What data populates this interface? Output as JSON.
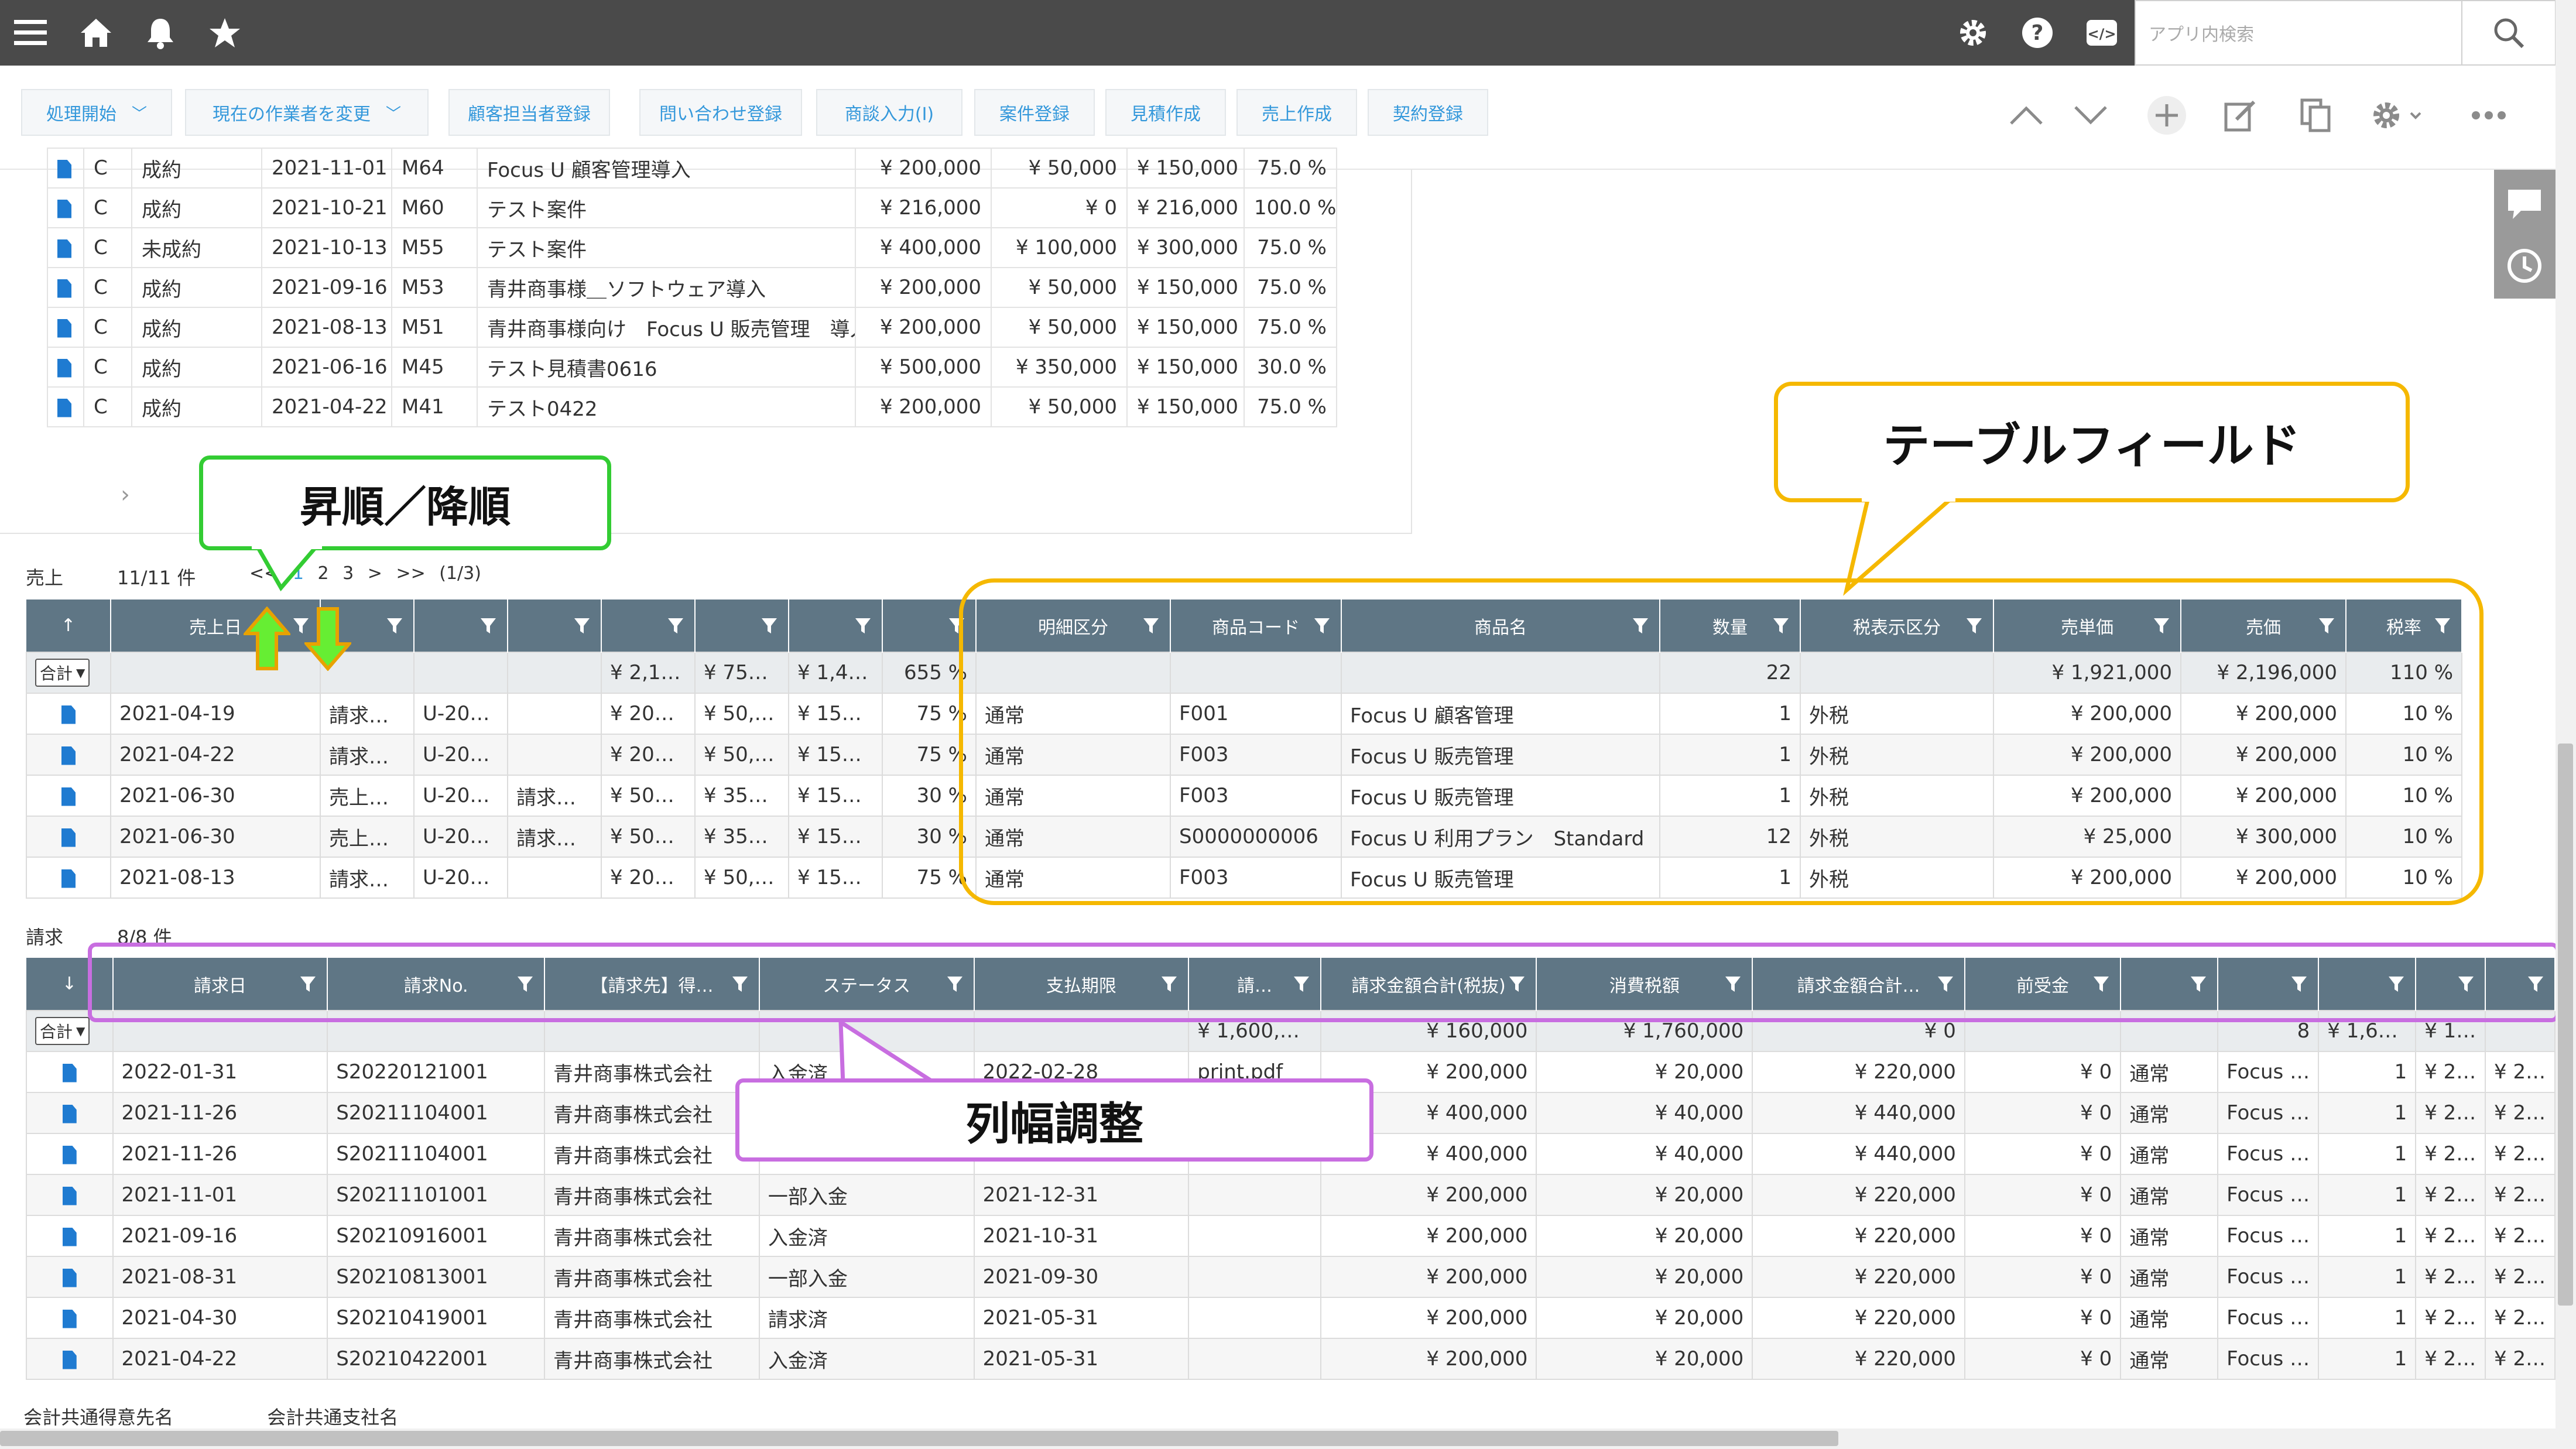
{
  "topbar": {
    "search_placeholder": "アプリ内検索"
  },
  "actions": [
    {
      "label": "処理開始",
      "dropdown": true
    },
    {
      "label": "現在の作業者を変更",
      "dropdown": true
    },
    {
      "label": "顧客担当者登録"
    },
    {
      "label": "問い合わせ登録"
    },
    {
      "label": "商談入力(I)"
    },
    {
      "label": "案件登録"
    },
    {
      "label": "見積作成"
    },
    {
      "label": "売上作成"
    },
    {
      "label": "契約登録"
    }
  ],
  "upper_table": {
    "rows": [
      [
        "C",
        "成約",
        "2021-11-01",
        "M64",
        "Focus U 顧客管理導入",
        "¥ 200,000",
        "¥ 50,000",
        "¥ 150,000",
        "75.0 %"
      ],
      [
        "C",
        "成約",
        "2021-10-21",
        "M60",
        "テスト案件",
        "¥ 216,000",
        "¥ 0",
        "¥ 216,000",
        "100.0 %"
      ],
      [
        "C",
        "未成約",
        "2021-10-13",
        "M55",
        "テスト案件",
        "¥ 400,000",
        "¥ 100,000",
        "¥ 300,000",
        "75.0 %"
      ],
      [
        "C",
        "成約",
        "2021-09-16",
        "M53",
        "青井商事様＿ソフトウェア導入",
        "¥ 200,000",
        "¥ 50,000",
        "¥ 150,000",
        "75.0 %"
      ],
      [
        "C",
        "成約",
        "2021-08-13",
        "M51",
        "青井商事様向け　Focus U 販売管理　導入",
        "¥ 200,000",
        "¥ 50,000",
        "¥ 150,000",
        "75.0 %"
      ],
      [
        "C",
        "成約",
        "2021-06-16",
        "M45",
        "テスト見積書0616",
        "¥ 500,000",
        "¥ 350,000",
        "¥ 150,000",
        "30.0 %"
      ],
      [
        "C",
        "成約",
        "2021-04-22",
        "M41",
        "テスト0422",
        "¥ 200,000",
        "¥ 50,000",
        "¥ 150,000",
        "75.0 %"
      ]
    ]
  },
  "sales": {
    "label": "売上",
    "count": "11/11 件",
    "pager": {
      "first": "<<",
      "pages": [
        "1",
        "2",
        "3"
      ],
      "current": "1",
      "next": ">",
      "last": ">>",
      "info": "(1/3)"
    },
    "headers": [
      "↑",
      "売上日",
      "",
      "",
      "",
      "",
      "",
      "",
      "",
      "明細区分",
      "商品コード",
      "商品名",
      "数量",
      "税表示区分",
      "売単価",
      "売価",
      "税率"
    ],
    "total_select": "合計",
    "totals": [
      "",
      "",
      "",
      "",
      "",
      "¥ 2,19…",
      "¥ 750,…",
      "¥ 1,44…",
      "655 %",
      "",
      "",
      "",
      "22",
      "",
      "¥ 1,921,000",
      "¥ 2,196,000",
      "110 %"
    ],
    "rows": [
      [
        "2021-04-19",
        "請求処…",
        "U-202…",
        "",
        "¥ 200,…",
        "¥ 50,0…",
        "¥ 150,…",
        "75 %",
        "通常",
        "F001",
        "Focus U 顧客管理",
        "1",
        "外税",
        "¥ 200,000",
        "¥ 200,000",
        "10 %"
      ],
      [
        "2021-04-22",
        "請求処…",
        "U-202…",
        "",
        "¥ 200,…",
        "¥ 50,0…",
        "¥ 150,…",
        "75 %",
        "通常",
        "F003",
        "Focus U 販売管理",
        "1",
        "外税",
        "¥ 200,000",
        "¥ 200,000",
        "10 %"
      ],
      [
        "2021-06-30",
        "売上未…",
        "U-202…",
        "請求書…",
        "¥ 500,…",
        "¥ 350,…",
        "¥ 150,…",
        "30 %",
        "通常",
        "F003",
        "Focus U 販売管理",
        "1",
        "外税",
        "¥ 200,000",
        "¥ 200,000",
        "10 %"
      ],
      [
        "2021-06-30",
        "売上未…",
        "U-202…",
        "請求書…",
        "¥ 500,…",
        "¥ 350,…",
        "¥ 150,…",
        "30 %",
        "通常",
        "S0000000006",
        "Focus U 利用プラン　Standard",
        "12",
        "外税",
        "¥ 25,000",
        "¥ 300,000",
        "10 %"
      ],
      [
        "2021-08-13",
        "請求処…",
        "U-202…",
        "",
        "¥ 200,…",
        "¥ 50,0…",
        "¥ 150,…",
        "75 %",
        "通常",
        "F003",
        "Focus U 販売管理",
        "1",
        "外税",
        "¥ 200,000",
        "¥ 200,000",
        "10 %"
      ]
    ]
  },
  "invoice": {
    "label": "請求",
    "count": "8/8 件",
    "headers": [
      "↓",
      "請求日",
      "請求No.",
      "【請求先】得…",
      "ステータス",
      "支払期限",
      "請…",
      "請求金額合計(税抜)",
      "消費税額",
      "請求金額合計…",
      "前受金",
      "",
      "",
      "",
      "",
      ""
    ],
    "total_select": "合計",
    "totals": [
      "",
      "",
      "",
      "",
      "",
      "",
      "¥ 1,600,000",
      "¥ 160,000",
      "¥ 1,760,000",
      "¥ 0",
      "",
      "",
      "8",
      "¥ 1,60…",
      "¥ 1,60…"
    ],
    "rows": [
      [
        "2022-01-31",
        "S20220121001",
        "青井商事株式会社",
        "入金済",
        "2022-02-28",
        "print.pdf",
        "¥ 200,000",
        "¥ 20,000",
        "¥ 220,000",
        "¥ 0",
        "通常",
        "Focus …",
        "1",
        "¥ 200,…",
        "¥ 200,…"
      ],
      [
        "2021-11-26",
        "S20211104001",
        "青井商事株式会社",
        "",
        "",
        "",
        "¥ 400,000",
        "¥ 40,000",
        "¥ 440,000",
        "¥ 0",
        "通常",
        "Focus …",
        "1",
        "¥ 200,…",
        "¥ 200,…"
      ],
      [
        "2021-11-26",
        "S20211104001",
        "青井商事株式会社",
        "",
        "",
        "",
        "¥ 400,000",
        "¥ 40,000",
        "¥ 440,000",
        "¥ 0",
        "通常",
        "Focus …",
        "1",
        "¥ 200,…",
        "¥ 200,…"
      ],
      [
        "2021-11-01",
        "S20211101001",
        "青井商事株式会社",
        "一部入金",
        "2021-12-31",
        "",
        "¥ 200,000",
        "¥ 20,000",
        "¥ 220,000",
        "¥ 0",
        "通常",
        "Focus …",
        "1",
        "¥ 200,…",
        "¥ 200,…"
      ],
      [
        "2021-09-16",
        "S20210916001",
        "青井商事株式会社",
        "入金済",
        "2021-10-31",
        "",
        "¥ 200,000",
        "¥ 20,000",
        "¥ 220,000",
        "¥ 0",
        "通常",
        "Focus …",
        "1",
        "¥ 200,…",
        "¥ 200,…"
      ],
      [
        "2021-08-31",
        "S20210813001",
        "青井商事株式会社",
        "一部入金",
        "2021-09-30",
        "",
        "¥ 200,000",
        "¥ 20,000",
        "¥ 220,000",
        "¥ 0",
        "通常",
        "Focus …",
        "1",
        "¥ 200,…",
        "¥ 200,…"
      ],
      [
        "2021-04-30",
        "S20210419001",
        "青井商事株式会社",
        "請求済",
        "2021-05-31",
        "",
        "¥ 200,000",
        "¥ 20,000",
        "¥ 220,000",
        "¥ 0",
        "通常",
        "Focus …",
        "1",
        "¥ 200,…",
        "¥ 200,…"
      ],
      [
        "2021-04-22",
        "S20210422001",
        "青井商事株式会社",
        "入金済",
        "2021-05-31",
        "",
        "¥ 200,000",
        "¥ 20,000",
        "¥ 220,000",
        "¥ 0",
        "通常",
        "Focus …",
        "1",
        "¥ 200,…",
        "¥ 200,…"
      ]
    ]
  },
  "callouts": {
    "sort": "昇順／降順",
    "table_field": "テーブルフィールド",
    "column_width": "列幅調整"
  },
  "callout_colors": {
    "sort": "#33cc33",
    "table_field": "#f5b800",
    "column_width": "#c86ee0"
  },
  "bottom": {
    "label1": "会計共通得意先名",
    "label2": "会計共通支社名"
  },
  "colors": {
    "topbar": "#4a4a4a",
    "accent": "#3498db",
    "header": "#5f7685",
    "doc_icon": "#1f7bd1"
  },
  "icons": [
    "menu-icon",
    "home-icon",
    "bell-icon",
    "star-icon",
    "gear-icon",
    "help-icon",
    "code-icon",
    "search-icon",
    "chevron-up-icon",
    "chevron-down-icon",
    "plus-icon",
    "edit-icon",
    "copy-icon",
    "more-icon",
    "comment-icon",
    "history-icon",
    "filter-icon",
    "document-icon"
  ]
}
